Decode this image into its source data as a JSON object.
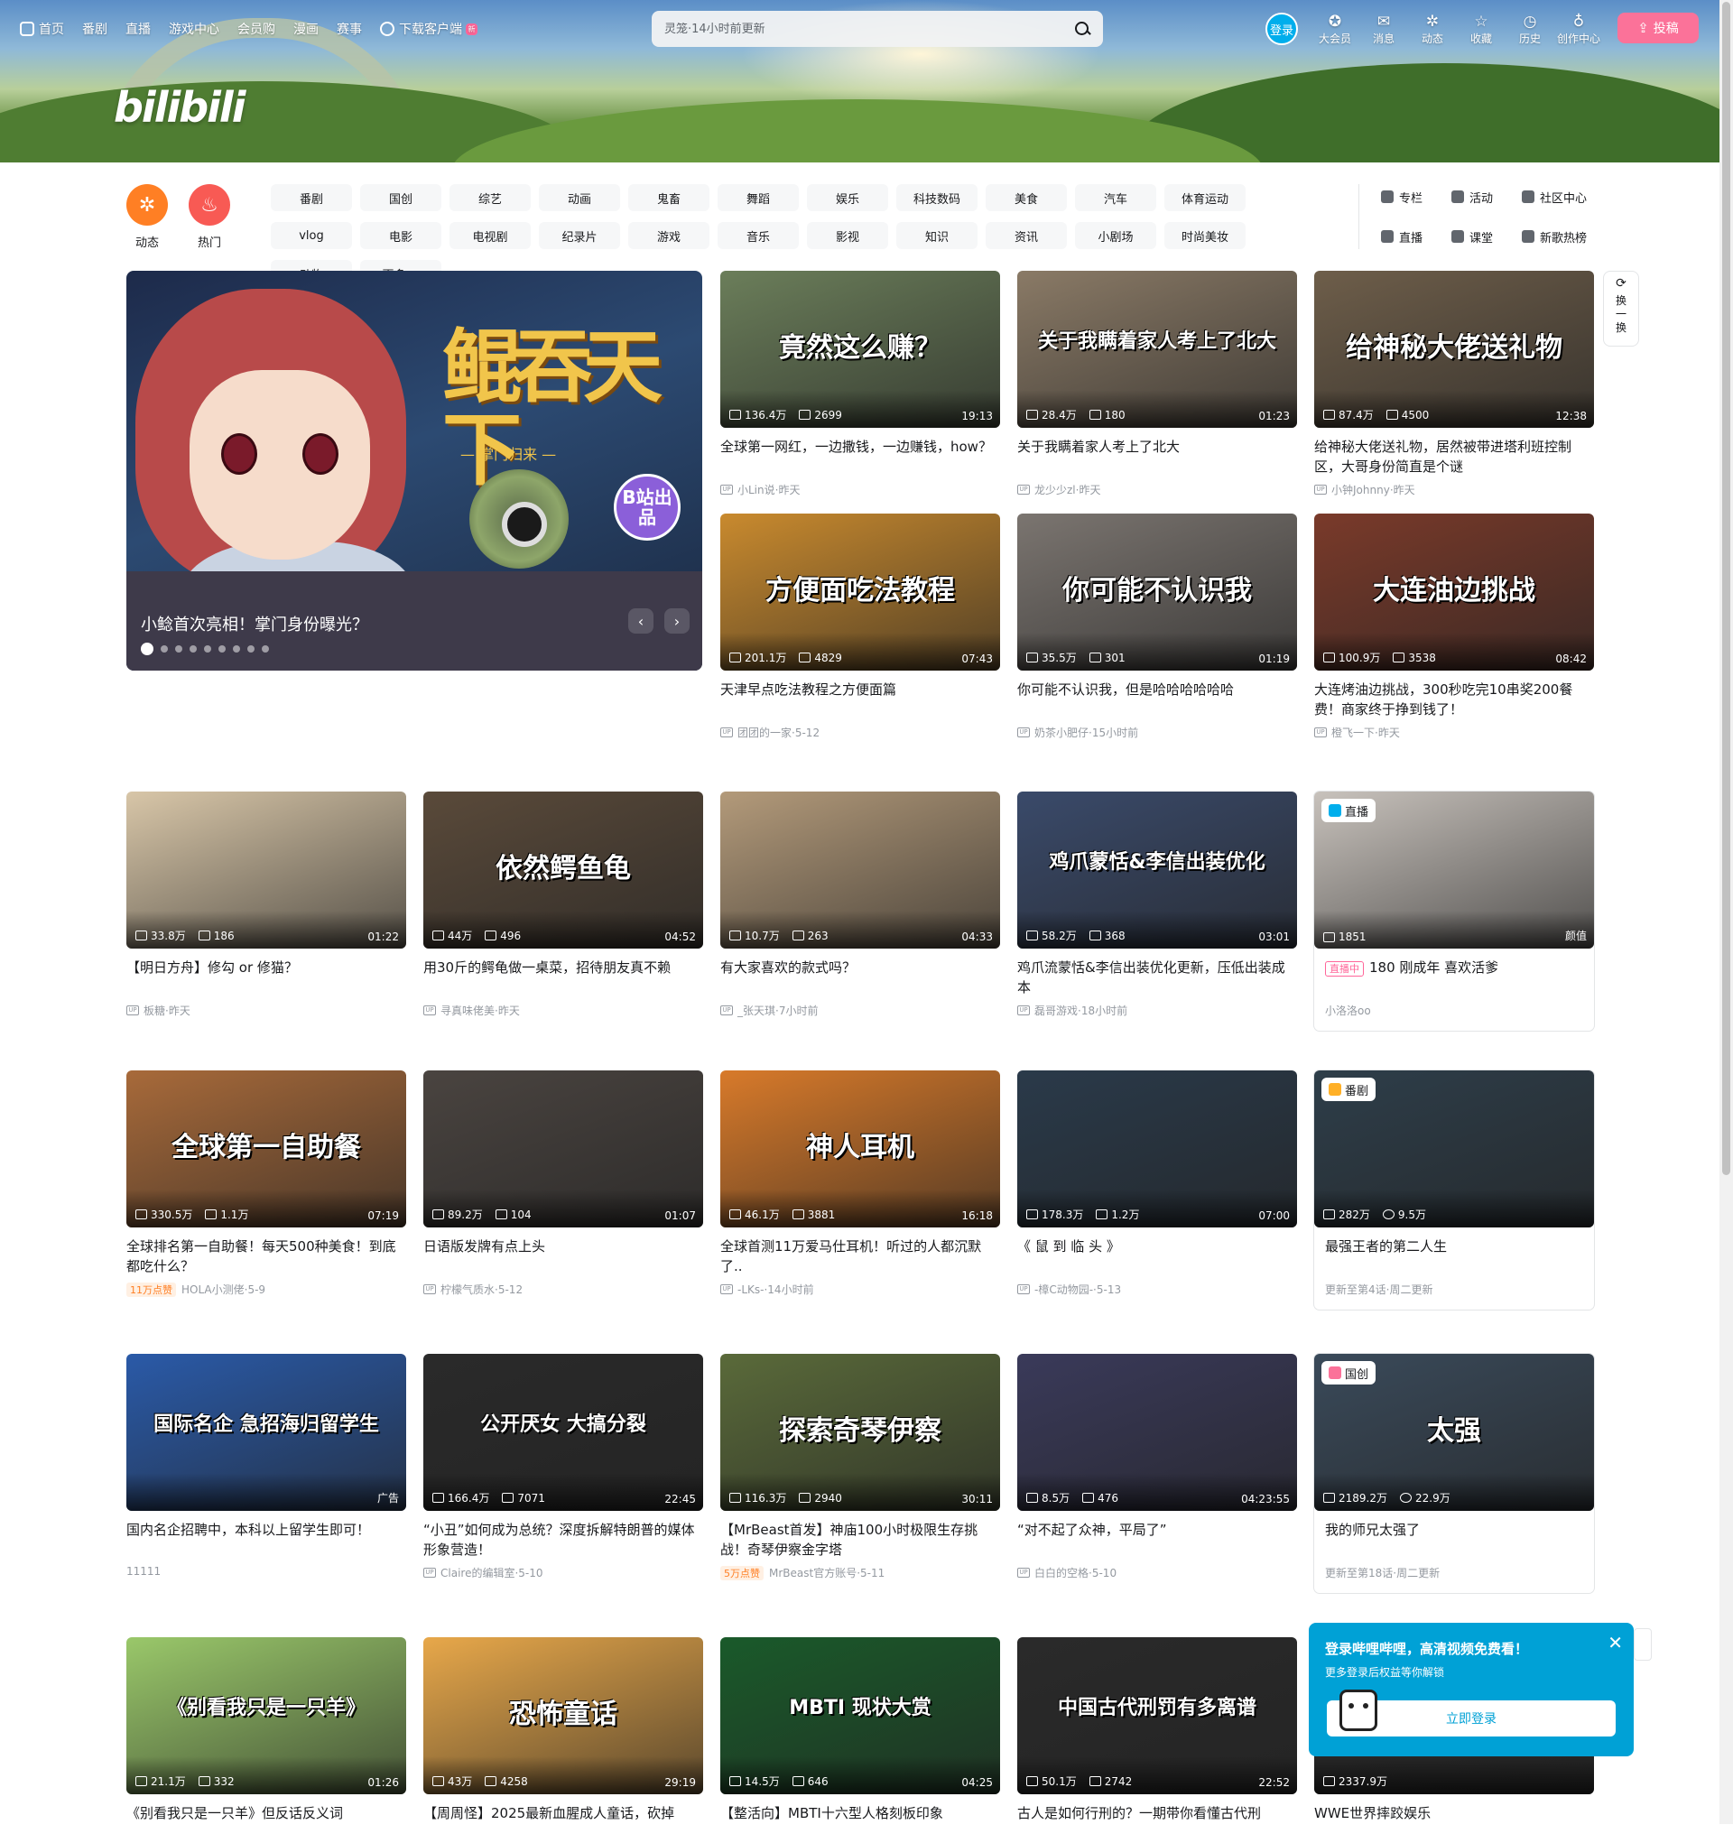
{
  "topnav": {
    "left": [
      {
        "label": "首页",
        "icon": "tv-icon"
      },
      {
        "label": "番剧"
      },
      {
        "label": "直播"
      },
      {
        "label": "游戏中心"
      },
      {
        "label": "会员购"
      },
      {
        "label": "漫画"
      },
      {
        "label": "赛事"
      },
      {
        "label": "下载客户端",
        "icon": "download-icon",
        "badge": "新"
      }
    ],
    "search_placeholder": "灵笼·14小时前更新",
    "login_label": "登录",
    "right": [
      {
        "label": "大会员",
        "glyph": "✪"
      },
      {
        "label": "消息",
        "glyph": "✉"
      },
      {
        "label": "动态",
        "glyph": "✲"
      },
      {
        "label": "收藏",
        "glyph": "☆"
      },
      {
        "label": "历史",
        "glyph": "◷"
      },
      {
        "label": "创作中心",
        "glyph": "♁"
      }
    ],
    "upload_label": "投稿"
  },
  "logo": "bilibili",
  "channels": {
    "big": [
      {
        "label": "动态",
        "color": "#ff7f24",
        "glyph": "✲"
      },
      {
        "label": "热门",
        "color": "#f85a54",
        "glyph": "♨"
      }
    ],
    "chips": [
      "番剧",
      "国创",
      "综艺",
      "动画",
      "鬼畜",
      "舞蹈",
      "娱乐",
      "科技数码",
      "美食",
      "汽车",
      "体育运动",
      "vlog",
      "电影",
      "电视剧",
      "纪录片",
      "游戏",
      "音乐",
      "影视",
      "知识",
      "资讯",
      "小剧场",
      "时尚美妆",
      "动物",
      "更多 ⌄"
    ],
    "tools": [
      "专栏",
      "活动",
      "社区中心",
      "直播",
      "课堂",
      "新歌热榜"
    ]
  },
  "carousel": {
    "art_title": "鲲吞天下",
    "art_subtitle": "— 掌门归来 —",
    "badge": "B站出品",
    "caption": "小鲶首次亮相！掌门身份曝光？",
    "dots": 9
  },
  "refresh": {
    "label": "换一换"
  },
  "cards": [
    {
      "title": "全球第一网红，一边撒钱，一边赚钱，how？",
      "views": "136.4万",
      "danmaku": "2699",
      "duration": "19:13",
      "author": "小Lin说",
      "date": "昨天",
      "overlay": "竟然这么赚？",
      "bg": "#6b7e5a"
    },
    {
      "title": "关于我瞒着家人考上了北大",
      "views": "28.4万",
      "danmaku": "180",
      "duration": "01:23",
      "author": "龙少少zl",
      "date": "昨天",
      "overlay": "关于我瞒着家人考上了北大",
      "bg": "#8a7a66"
    },
    {
      "title": "给神秘大佬送礼物，居然被带进塔利班控制区，大哥身份简直是个谜",
      "views": "87.4万",
      "danmaku": "4500",
      "duration": "12:38",
      "author": "小钟Johnny",
      "date": "昨天",
      "overlay": "给神秘大佬送礼物",
      "bg": "#6e5e4a"
    },
    {
      "title": "天津早点吃法教程之方便面篇",
      "views": "201.1万",
      "danmaku": "4829",
      "duration": "07:43",
      "author": "团团的一家",
      "date": "5-12",
      "overlay": "方便面吃法教程",
      "bg": "#c98a2e"
    },
    {
      "title": "你可能不认识我，但是哈哈哈哈哈哈",
      "views": "35.5万",
      "danmaku": "301",
      "duration": "01:19",
      "author": "奶茶小肥仔",
      "date": "15小时前",
      "overlay": "你可能不认识我",
      "bg": "#7b7570"
    },
    {
      "title": "大连烤油边挑战，300秒吃完10串奖200餐费！商家终于挣到钱了！",
      "views": "100.9万",
      "danmaku": "3538",
      "duration": "08:42",
      "author": "橙飞一下",
      "date": "昨天",
      "overlay": "大连油边挑战",
      "bg": "#7a3a2a"
    },
    {
      "title": "【明日方舟】修勾 or 修猫？",
      "views": "33.8万",
      "danmaku": "186",
      "duration": "01:22",
      "author": "板糖",
      "date": "昨天",
      "overlay": "",
      "bg": "#d8c6a8"
    },
    {
      "title": "用30斤的鳄龟做一桌菜，招待朋友真不赖",
      "views": "44万",
      "danmaku": "496",
      "duration": "04:52",
      "author": "寻真味佬美",
      "date": "昨天",
      "overlay": "依然鳄鱼龟",
      "bg": "#5a4a3a"
    },
    {
      "title": "有大家喜欢的款式吗？",
      "views": "10.7万",
      "danmaku": "263",
      "duration": "04:33",
      "author": "_张天琪",
      "date": "7小时前",
      "overlay": "",
      "bg": "#b39a7a"
    },
    {
      "title": "鸡爪流蒙恬&李信出装优化更新，压低出装成本",
      "views": "58.2万",
      "danmaku": "368",
      "duration": "03:01",
      "author": "磊哥游戏",
      "date": "18小时前",
      "overlay": "鸡爪蒙恬&李信出装优化",
      "bg": "#3a4a6a"
    },
    {
      "title": "180 刚成年 喜欢活爹",
      "views": "1851",
      "danmaku": "",
      "duration": "颜值",
      "author": "小洛洛oo",
      "date": "",
      "overlay": "",
      "bg": "#c8c2bc",
      "tag": "直播",
      "live": "直播中"
    },
    {
      "title": "全球排名第一自助餐！每天500种美食！到底都吃什么？",
      "views": "330.5万",
      "danmaku": "1.1万",
      "duration": "07:19",
      "author": "HOLA小测佬",
      "date": "5-9",
      "overlay": "全球第一自助餐",
      "bg": "#a86a3a",
      "hot": "11万点赞"
    },
    {
      "title": "日语版发牌有点上头",
      "views": "89.2万",
      "danmaku": "104",
      "duration": "01:07",
      "author": "柠檬气质水",
      "date": "5-12",
      "overlay": "",
      "bg": "#4a4440"
    },
    {
      "title": "全球首测11万爱马仕耳机！听过的人都沉默了..",
      "views": "46.1万",
      "danmaku": "3881",
      "duration": "16:18",
      "author": "-LKs-",
      "date": "14小时前",
      "overlay": "神人耳机",
      "bg": "#d87a2a"
    },
    {
      "title": "《 鼠 到 临 头 》",
      "views": "178.3万",
      "danmaku": "1.2万",
      "duration": "07:00",
      "author": "-樟C动物园-",
      "date": "5-13",
      "overlay": "",
      "bg": "#2a3a4a"
    },
    {
      "title": "最强王者的第二人生",
      "views": "282万",
      "danmaku": "9.5万",
      "duration": "",
      "author": "更新至第4话",
      "date": "周二更新",
      "overlay": "",
      "bg": "#2e3e4a",
      "tag": "番剧"
    },
    {
      "title": "国内名企招聘中，本科以上留学生即可！",
      "views": "",
      "danmaku": "",
      "duration": "",
      "author": "11111",
      "date": "",
      "overlay": "国际名企 急招海归留学生",
      "bg": "#2a5aa8",
      "ad": "广告"
    },
    {
      "title": "“小丑”如何成为总统？深度拆解特朗普的媒体形象营造！",
      "views": "166.4万",
      "danmaku": "7071",
      "duration": "22:45",
      "author": "Claire的编辑室",
      "date": "5-10",
      "overlay": "公开厌女 大搞分裂",
      "bg": "#2a2a2a"
    },
    {
      "title": "【MrBeast首发】神庙100小时极限生存挑战！奇琴伊察金字塔",
      "views": "116.3万",
      "danmaku": "2940",
      "duration": "30:11",
      "author": "MrBeast官方账号",
      "date": "5-11",
      "overlay": "探索奇琴伊察",
      "bg": "#5a6a3a",
      "hot": "5万点赞"
    },
    {
      "title": "“对不起了众神，平局了”",
      "views": "8.5万",
      "danmaku": "476",
      "duration": "04:23:55",
      "author": "白白的空格",
      "date": "5-10",
      "overlay": "",
      "bg": "#3a3a5a"
    },
    {
      "title": "我的师兄太强了",
      "views": "2189.2万",
      "danmaku": "22.9万",
      "duration": "",
      "author": "更新至第18话",
      "date": "周二更新",
      "overlay": "太强",
      "bg": "#3a4a5a",
      "tag": "国创"
    },
    {
      "title": "《别看我只是一只羊》但反话反义词",
      "views": "21.1万",
      "danmaku": "332",
      "duration": "01:26",
      "author": "",
      "date": "",
      "overlay": "《别看我只是一只羊》",
      "bg": "#9ac86a"
    },
    {
      "title": "【周周怪】2025最新血腥成人童话，砍掉",
      "views": "43万",
      "danmaku": "4258",
      "duration": "29:19",
      "author": "",
      "date": "",
      "overlay": "恐怖童话",
      "bg": "#e8a84a"
    },
    {
      "title": "【整活向】MBTI十六型人格刻板印象",
      "views": "14.5万",
      "danmaku": "646",
      "duration": "04:25",
      "author": "",
      "date": "",
      "overlay": "MBTI 现状大赏",
      "bg": "#1a5a2a"
    },
    {
      "title": "古人是如何行刑的？一期带你看懂古代刑",
      "views": "50.1万",
      "danmaku": "2742",
      "duration": "22:52",
      "author": "",
      "date": "",
      "overlay": "中国古代刑罚有多离谱",
      "bg": "#2a2a2a"
    },
    {
      "title": "WWE世界摔跤娱乐",
      "views": "2337.9万",
      "danmaku": "",
      "duration": "",
      "author": "",
      "date": "",
      "overlay": "",
      "bg": "#2a2a2a"
    }
  ],
  "popup": {
    "title": "登录哔哩哔哩，高清视频免费看！",
    "subtitle": "更多登录后权益等你解锁",
    "button": "立即登录"
  },
  "colors": {
    "brand_pink": "#fb7299",
    "brand_blue": "#00aeec",
    "text": "#18191c",
    "meta": "#9499a0"
  }
}
